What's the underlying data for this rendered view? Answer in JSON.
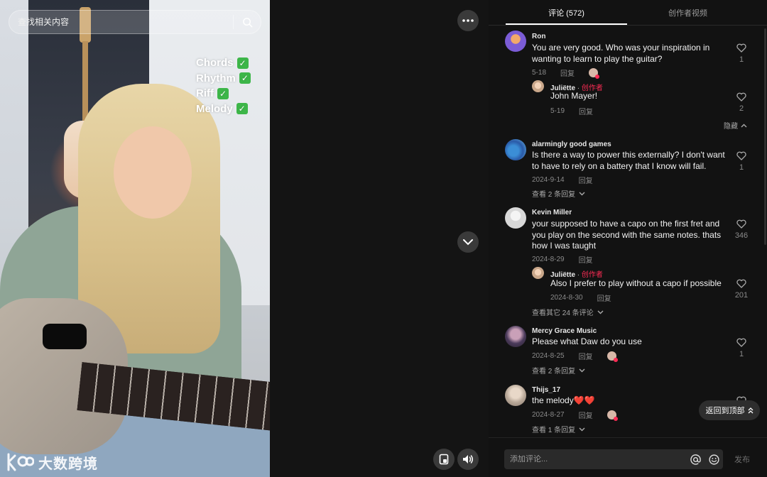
{
  "video": {
    "search_placeholder": "查找相关内容",
    "overlay_lines": [
      "Chords",
      "Rhythm",
      "Riff",
      "Melody"
    ],
    "watermark_text": "大数跨境"
  },
  "tabs": {
    "comments_label": "评论 (572)",
    "creator_videos_label": "创作者视频"
  },
  "reply_label": "回复",
  "author_tag": "创作者",
  "hide_label": "隐藏",
  "comments": [
    {
      "name": "Ron",
      "text": "You are very good. Who was your inspiration in wanting to learn to play the guitar?",
      "date": "5-18",
      "likes": "1",
      "reply": {
        "name": "Juliëtte",
        "text": "John Mayer!",
        "date": "5-19",
        "likes": "2"
      }
    },
    {
      "name": "alarmingly good games",
      "text": "Is there a way to power this externally? I don't want to have to rely on a battery that I know will fail.",
      "date": "2024-9-14",
      "likes": "1",
      "more": "查看 2 条回复"
    },
    {
      "name": "Kevin Miller",
      "text": "your supposed to have a capo on the first fret and you play on the second with the same notes. thats how I was taught",
      "date": "2024-8-29",
      "likes": "346",
      "reply": {
        "name": "Juliëtte",
        "text": "Also I prefer to play without a capo if possible",
        "date": "2024-8-30",
        "likes": "201"
      },
      "more": "查看其它 24 条评论"
    },
    {
      "name": "Mercy Grace Music",
      "text": "Please what Daw do you use",
      "date": "2024-8-25",
      "likes": "1",
      "more": "查看 2 条回复"
    },
    {
      "name": "Thijs_17",
      "text": "the melody❤️❤️",
      "date": "2024-8-27",
      "more": "查看 1 条回复"
    }
  ],
  "back_to_top_label": "返回到顶部",
  "composer": {
    "placeholder": "添加评论...",
    "post_label": "发布"
  },
  "colors": {
    "accent_pink": "#fe2c55",
    "check_green": "#3db649",
    "panel_bg": "#121212"
  }
}
